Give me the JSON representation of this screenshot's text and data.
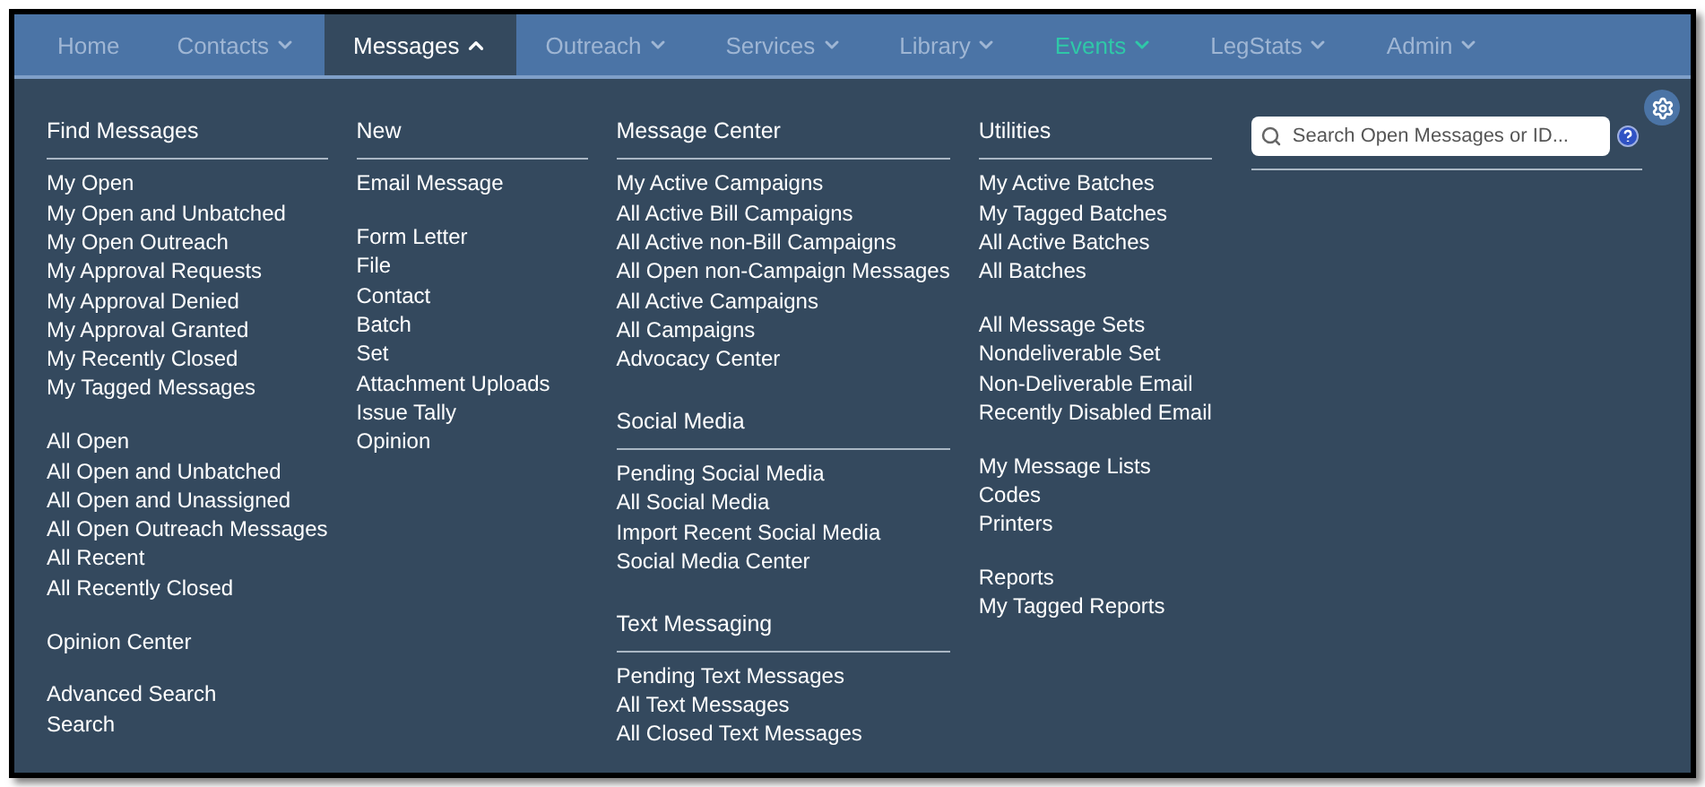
{
  "nav": [
    {
      "label": "Home",
      "dropdown": false,
      "selected": false,
      "highlighted": false
    },
    {
      "label": "Contacts",
      "dropdown": true,
      "selected": false,
      "highlighted": false
    },
    {
      "label": "Messages",
      "dropdown": true,
      "selected": true,
      "highlighted": false
    },
    {
      "label": "Outreach",
      "dropdown": true,
      "selected": false,
      "highlighted": false
    },
    {
      "label": "Services",
      "dropdown": true,
      "selected": false,
      "highlighted": false
    },
    {
      "label": "Library",
      "dropdown": true,
      "selected": false,
      "highlighted": false
    },
    {
      "label": "Events",
      "dropdown": true,
      "selected": false,
      "highlighted": true
    },
    {
      "label": "LegStats",
      "dropdown": true,
      "selected": false,
      "highlighted": false
    },
    {
      "label": "Admin",
      "dropdown": true,
      "selected": false,
      "highlighted": false
    }
  ],
  "columns": [
    {
      "sections": [
        {
          "heading": "Find Messages",
          "groups": [
            [
              "My Open",
              "My Open and Unbatched",
              "My Open Outreach",
              "My Approval Requests",
              "My Approval Denied",
              "My Approval Granted",
              "My Recently Closed",
              "My Tagged Messages"
            ],
            [
              "All Open",
              "All Open and Unbatched",
              "All Open and Unassigned",
              "All Open Outreach Messages",
              "All Recent",
              "All Recently Closed"
            ],
            [
              "Opinion Center"
            ],
            [
              "Advanced Search",
              "Search"
            ]
          ]
        }
      ]
    },
    {
      "sections": [
        {
          "heading": "New",
          "groups": [
            [
              "Email Message"
            ],
            [
              "Form Letter",
              "File",
              "Contact",
              "Batch",
              "Set",
              "Attachment Uploads",
              "Issue Tally",
              "Opinion"
            ]
          ]
        }
      ]
    },
    {
      "sections": [
        {
          "heading": "Message Center",
          "groups": [
            [
              "My Active Campaigns",
              "All Active Bill Campaigns",
              "All Active non-Bill Campaigns",
              "All Open non-Campaign Messages",
              "All Active Campaigns",
              "All Campaigns",
              "Advocacy Center"
            ]
          ]
        },
        {
          "heading": "Social Media",
          "groups": [
            [
              "Pending Social Media",
              "All Social Media",
              "Import Recent Social Media",
              "Social Media Center"
            ]
          ]
        },
        {
          "heading": "Text Messaging",
          "groups": [
            [
              "Pending Text Messages",
              "All Text Messages",
              "All Closed Text Messages"
            ]
          ]
        }
      ]
    },
    {
      "sections": [
        {
          "heading": "Utilities",
          "groups": [
            [
              "My Active Batches",
              "My Tagged Batches",
              "All Active Batches",
              "All Batches"
            ],
            [
              "All Message Sets",
              "Nondeliverable Set",
              "Non-Deliverable Email",
              "Recently Disabled Email"
            ],
            [
              "My Message Lists",
              "Codes",
              "Printers"
            ],
            [
              "Reports",
              "My Tagged Reports"
            ]
          ]
        }
      ]
    }
  ],
  "search": {
    "placeholder": "Search Open Messages or ID..."
  }
}
